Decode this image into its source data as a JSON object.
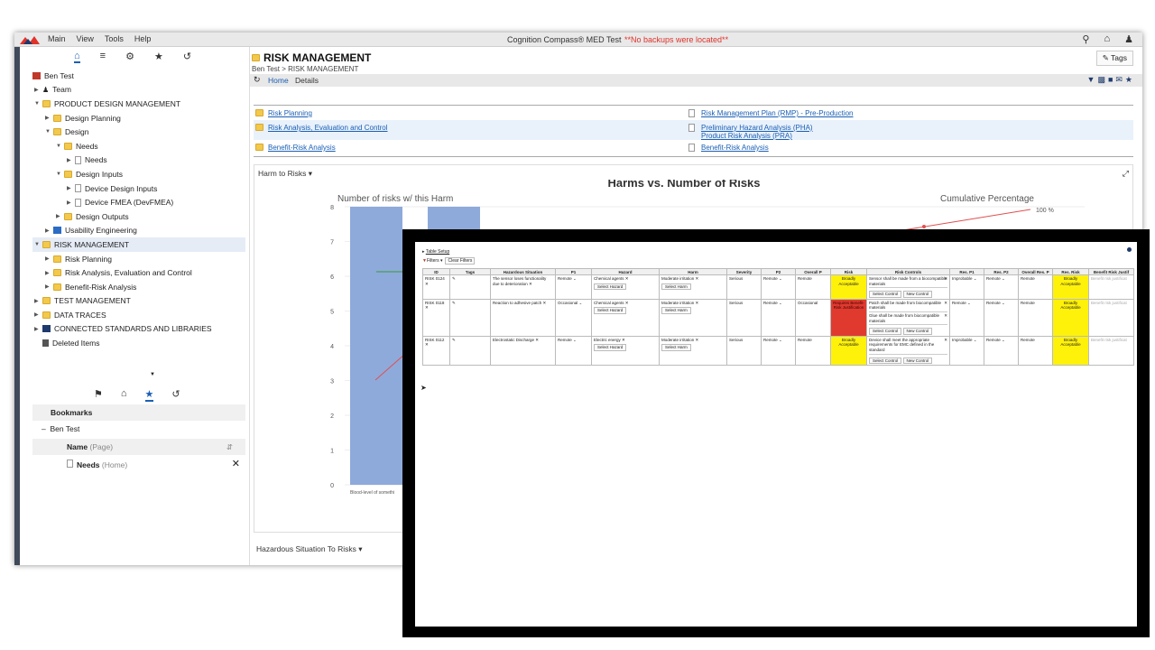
{
  "menubar": {
    "menus": [
      "Main",
      "View",
      "Tools",
      "Help"
    ],
    "app_title": "Cognition Compass® MED Test",
    "warning": "**No backups were located**"
  },
  "sidebar": {
    "root": "Ben Test",
    "tree": [
      {
        "label": "Team",
        "indent": 1,
        "icon": "team"
      },
      {
        "label": "PRODUCT DESIGN MANAGEMENT",
        "indent": 1,
        "icon": "folder",
        "open": true
      },
      {
        "label": "Design Planning",
        "indent": 2,
        "icon": "folder"
      },
      {
        "label": "Design",
        "indent": 2,
        "icon": "folder",
        "open": true
      },
      {
        "label": "Needs",
        "indent": 3,
        "icon": "folder",
        "open": true
      },
      {
        "label": "Needs",
        "indent": 4,
        "icon": "doc"
      },
      {
        "label": "Design Inputs",
        "indent": 3,
        "icon": "folder",
        "open": true
      },
      {
        "label": "Device Design Inputs",
        "indent": 4,
        "icon": "doc"
      },
      {
        "label": "Device FMEA (DevFMEA)",
        "indent": 4,
        "icon": "doc"
      },
      {
        "label": "Design Outputs",
        "indent": 3,
        "icon": "folder"
      },
      {
        "label": "Usability Engineering",
        "indent": 2,
        "icon": "tool"
      },
      {
        "label": "RISK MANAGEMENT",
        "indent": 1,
        "icon": "folder",
        "open": true,
        "selected": true
      },
      {
        "label": "Risk Planning",
        "indent": 2,
        "icon": "folder"
      },
      {
        "label": "Risk Analysis, Evaluation and Control",
        "indent": 2,
        "icon": "folder"
      },
      {
        "label": "Benefit-Risk Analysis",
        "indent": 2,
        "icon": "folder"
      },
      {
        "label": "TEST MANAGEMENT",
        "indent": 1,
        "icon": "folder"
      },
      {
        "label": "DATA TRACES",
        "indent": 1,
        "icon": "folder"
      },
      {
        "label": "CONNECTED STANDARDS AND LIBRARIES",
        "indent": 1,
        "icon": "book"
      },
      {
        "label": "Deleted Items",
        "indent": 1,
        "icon": "trash"
      }
    ],
    "bookmarks_title": "Bookmarks",
    "bookmark_user": "Ben Test",
    "bookmark_col": "Name",
    "bookmark_col_sub": "(Page)",
    "bookmark_item": "Needs",
    "bookmark_item_sub": "(Home)"
  },
  "page": {
    "title": "RISK MANAGEMENT",
    "crumb_root": "Ben Test",
    "crumb_current": "RISK MANAGEMENT",
    "tags_label": "Tags",
    "tab_home": "Home",
    "tab_details": "Details"
  },
  "links": {
    "left": [
      "Risk Planning",
      "Risk Analysis, Evaluation and Control",
      "Benefit-Risk Analysis"
    ],
    "right": [
      "Risk Management Plan (RMP) - Pre-Production",
      "Preliminary Hazard Analysis (PHA)",
      "Product Risk Analysis (PRA)",
      "Benefit-Risk Analysis"
    ]
  },
  "harm_section_label": "Harm to Risks",
  "haz_section_label": "Hazardous Situation To Risks",
  "chart_data": {
    "type": "bar",
    "title": "Harms vs. Number of Risks",
    "ylabel": "Number of risks w/ this Harm",
    "y2label": "Cumulative Percentage",
    "y2_tick": "100 %",
    "ylim": [
      0,
      8
    ],
    "yticks": [
      "0",
      "1",
      "2",
      "3",
      "4",
      "5",
      "6",
      "7",
      "8"
    ],
    "categories": [
      "Blood-level of somethi"
    ],
    "values": [
      8,
      8
    ],
    "cumulative_visible_pct": [
      100
    ]
  },
  "overlay": {
    "table_setup": "Table Setup",
    "filters": "Filters",
    "clear_filters": "Clear Filters",
    "columns": [
      "ID",
      "Tags",
      "Hazardous Situation",
      "P1",
      "Hazard",
      "Harm",
      "Severity",
      "P2",
      "Overall P",
      "Risk",
      "Risk Controls",
      "Res. P1",
      "Res. P2",
      "Overall Res. P",
      "Res. Risk",
      "Benefit Risk Justif"
    ],
    "select_hazard": "Select Hazard",
    "select_harm": "Select Harm",
    "select_control": "Select Control",
    "new_control": "New Control",
    "rows": [
      {
        "id": "RISK 0124",
        "situation": "The sensor loses functionality due to deterioration",
        "p1": "Remote",
        "hazard": "Chemical agents",
        "harm": "Moderate irritation",
        "severity": "Serious",
        "p2": "Remote",
        "overall": "Remote",
        "risk": "Broadly Acceptable",
        "risk_color": "#fff20a",
        "controls": [
          "Sensor shall be made from a biocompatible materials"
        ],
        "res_p1": "Improbable",
        "res_p2": "Remote",
        "res_overall": "Remote",
        "res_risk": "Broadly Acceptable",
        "justification": "Benefit risk justificat"
      },
      {
        "id": "RISK 0118",
        "situation": "Reaction to adhesive patch",
        "p1": "Occasional",
        "hazard": "Chemical agents",
        "harm": "Moderate irritation",
        "severity": "Serious",
        "p2": "Remote",
        "overall": "Occasional",
        "risk": "Requires Benefit-Risk Justification",
        "risk_color": "#e03a2f",
        "controls": [
          "Patch shall be made from biocompatible materials",
          "Glue shall be made from biocompatible materials"
        ],
        "res_p1": "Remote",
        "res_p2": "Remote",
        "res_overall": "Remote",
        "res_risk": "Broadly Acceptable",
        "justification": "Benefit risk justificat"
      },
      {
        "id": "RISK 0112",
        "situation": "Electrostatic Discharge",
        "p1": "Remote",
        "hazard": "Electric energy",
        "harm": "Moderate irritation",
        "severity": "Serious",
        "p2": "Remote",
        "overall": "Remote",
        "risk": "Broadly Acceptable",
        "risk_color": "#fff20a",
        "controls": [
          "Device shall meet the appropriate requirements for EMC defined in the standard"
        ],
        "res_p1": "Improbable",
        "res_p2": "Remote",
        "res_overall": "Remote",
        "res_risk": "Broadly Acceptable",
        "justification": "Benefit risk justificat"
      }
    ]
  },
  "colors": {
    "bar": "#8eaadb",
    "line_red": "#e05050",
    "line_green": "#3a9a3a",
    "link": "#1a5fb4"
  }
}
